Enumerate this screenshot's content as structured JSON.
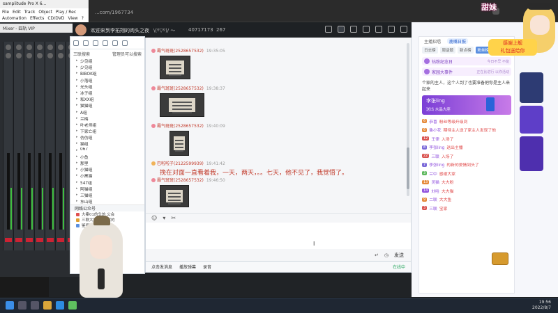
{
  "browser": {
    "url": "...com/1967734"
  },
  "samplitude": {
    "title": "samplitude Pro X 6...",
    "menu": [
      "File",
      "Edit",
      "Track",
      "Object",
      "Play / Rec",
      "Automation",
      "Effects",
      "CD/DVD",
      "View",
      "?"
    ],
    "mixer_title": "Mixer - 四轨 VIP"
  },
  "live_header": {
    "title": "欢迎来到李拓翔的肉头之夜",
    "motto": "\\(º▽º)/ 〜",
    "id": "40717173",
    "viewers": "267"
  },
  "qq_left": {
    "tabs": [
      "三联搜索",
      "管理员可以搜索"
    ],
    "groups": [
      "少见组",
      "少见组",
      "BIBOK组",
      "小落组",
      "光头组",
      "冰子组",
      "和XX组",
      "猫猫组",
      "A组",
      "兰梅",
      "叶老师组",
      "下家亡组",
      "仿仿组",
      "猫组",
      "067",
      "小鱼",
      "那里",
      "小猫组",
      "小黑猫",
      "547组",
      "阿猫组",
      "三猫组",
      "东山组"
    ],
    "section": "网络公众号",
    "online_rows": [
      "大秦01的头的 公会",
      "三联大宝: 就大家的",
      "鉴鉴猫: 无语组人"
    ]
  },
  "chat": {
    "messages": [
      {
        "sender": "霸气斑斑(2528657532)",
        "time": "19:35:05"
      },
      {
        "sender": "霸气斑斑(2528657532)",
        "time": "19:38:37"
      },
      {
        "sender": "霸气斑斑(2528657532)",
        "time": "19:40:09"
      },
      {
        "sender": "巴啦啦子(2122599939)",
        "time": "19:41:42",
        "text": "挽在对面一直看着我，一天，两天，。。七天，他不见了，我觉悟了。"
      },
      {
        "sender": "霸气斑斑(2528657532)",
        "time": "19:46:50"
      }
    ],
    "send_label": "发送"
  },
  "qq_bottom": {
    "items": [
      "点击发消息",
      "播放弹幕",
      "录音"
    ],
    "right_label": "在线中"
  },
  "right_panel": {
    "tabs": [
      "主播招唱",
      "鹿嘴日报"
    ],
    "sub_tabs": [
      "日志榜",
      "周话题",
      "新点榜",
      "粉丝榜"
    ],
    "badge_1": {
      "text": "钻粉纪念日",
      "sub": "今日不早 不能"
    },
    "badge_2": {
      "text": "家园大事件",
      "sub": "正在比进行 以你活动"
    },
    "note": "个家的主人，这个人到了也要准备把你是主人来起来",
    "gift": {
      "title": "李张ling",
      "sub": "送出 水晶大座"
    },
    "rows": [
      {
        "lv": "6",
        "name": "恭喜",
        "text": "粉丝等级升级到",
        "color": "#e58a3a"
      },
      {
        "lv": "6",
        "name": "鲁小花",
        "text": "期待主人送了家主人发现了他",
        "color": "#e58a3a"
      },
      {
        "lv": "12",
        "name": "王律",
        "text": "入场了",
        "color": "#d9534f"
      },
      {
        "lv": "8",
        "name": "李张ling",
        "text": "送出主播",
        "color": "#7b6ad8"
      },
      {
        "lv": "22",
        "name": "三联",
        "text": "入场了",
        "color": "#d9534f"
      },
      {
        "lv": "7",
        "name": "李张ling",
        "text": "的新的爱情到头了",
        "color": "#7b6ad8"
      },
      {
        "lv": "3",
        "name": "兰中",
        "text": "感谢大家",
        "color": "#5cb85c"
      },
      {
        "lv": "13",
        "name": "灵猫",
        "text": "大大粉",
        "color": "#e58a3a"
      },
      {
        "lv": "14",
        "name": "刘哈",
        "text": "大大猫",
        "color": "#9254de"
      },
      {
        "lv": "9",
        "name": "二联",
        "text": "大大鱼",
        "color": "#e58a3a"
      },
      {
        "lv": "3",
        "name": "三联",
        "text": "宝家",
        "color": "#d9534f"
      }
    ]
  },
  "taskbar": {
    "time": "19:56",
    "date": "2022/8/7"
  },
  "overlay": {
    "stamp": "甜妹",
    "logo_line1": "感谢上舰",
    "logo_line2": "礼包送给你"
  },
  "colors": {
    "accent": "#c23b2b",
    "brand_purple": "#7b3fd6",
    "qq_blue": "#5a8fe0"
  }
}
